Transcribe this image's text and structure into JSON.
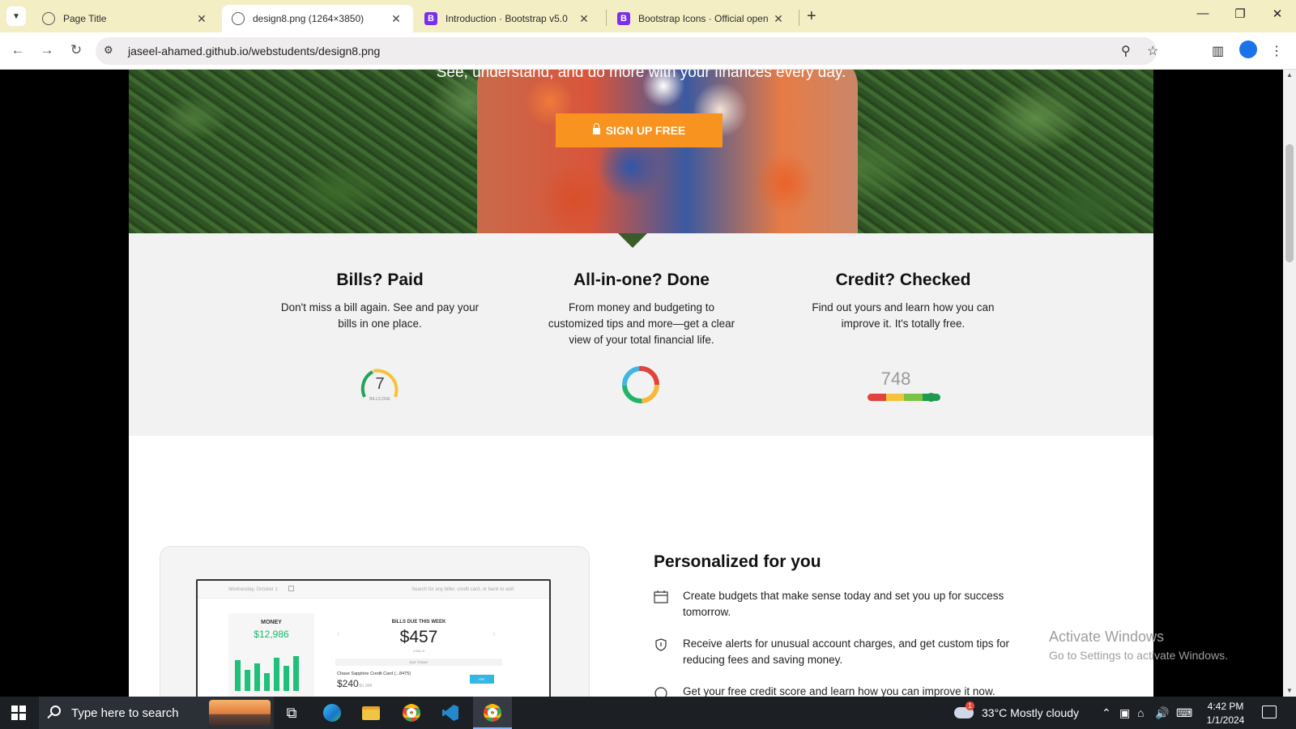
{
  "browser": {
    "tabs": [
      {
        "title": "Page Title",
        "favicon": "globe-icon",
        "active": false
      },
      {
        "title": "design8.png (1264×3850)",
        "favicon": "globe-icon",
        "active": true
      },
      {
        "title": "Introduction · Bootstrap v5.0",
        "favicon": "bootstrap-icon",
        "active": false
      },
      {
        "title": "Bootstrap Icons · Official open s",
        "favicon": "bootstrap-icon",
        "active": false
      }
    ],
    "bootstrap_letter": "B",
    "url": "jaseel-ahamed.github.io/webstudents/design8.png",
    "new_tab": "+",
    "window_controls": {
      "minimize": "—",
      "restore": "❐",
      "close": "✕"
    }
  },
  "hero": {
    "tagline": "See, understand, and do more with your finances every day.",
    "signup_label": "SIGN UP FREE"
  },
  "features": [
    {
      "title": "Bills? Paid",
      "text": "Don't miss a bill again. See and pay your bills in one place."
    },
    {
      "title": "All-in-one? Done",
      "text": "From money and budgeting to customized tips and more—get a clear view of your total financial life."
    },
    {
      "title": "Credit? Checked",
      "text": "Find out yours and learn how you can improve it. It's totally free."
    }
  ],
  "bills_gauge": {
    "value": "7",
    "label": "BILLS DUE"
  },
  "credit_score": {
    "value": "748"
  },
  "mockup": {
    "date": "Wednesday, October 1",
    "search": "Search for any biller, credit card, or bank to add",
    "money_label": "MONEY",
    "money_amount": "$12,986",
    "bills_label": "BILLS DUE THIS WEEK",
    "bills_amount": "$457",
    "bills_sub": "4 BILLS",
    "due_today": "DUE TODAY",
    "card_name": "Chase Sapphire Credit Card (...8475)",
    "card_amount": "$240",
    "card_of": "/$1,986",
    "pay_label": "PAY",
    "bar_values": [
      0.8,
      0.55,
      0.7,
      0.45,
      0.85,
      0.65,
      0.9
    ]
  },
  "personalized": {
    "title": "Personalized for you",
    "items": [
      {
        "icon": "calendar-icon",
        "text": "Create budgets that make sense today and set you up for success tomorrow."
      },
      {
        "icon": "shield-icon",
        "text": "Receive alerts for unusual account charges, and get custom tips for reducing fees and saving money."
      },
      {
        "icon": "gauge-icon",
        "text": "Get your free credit score and learn how you can improve it now."
      }
    ]
  },
  "watermark": {
    "line1": "Activate Windows",
    "line2": "Go to Settings to activate Windows."
  },
  "taskbar": {
    "search_placeholder": "Type here to search",
    "weather": "33°C  Mostly cloudy",
    "weather_badge": "1",
    "time": "4:42 PM",
    "date": "1/1/2024"
  },
  "colors": {
    "accent_orange": "#f7931e",
    "money_green": "#1bb86c",
    "tab_strip": "#f4eec5"
  }
}
